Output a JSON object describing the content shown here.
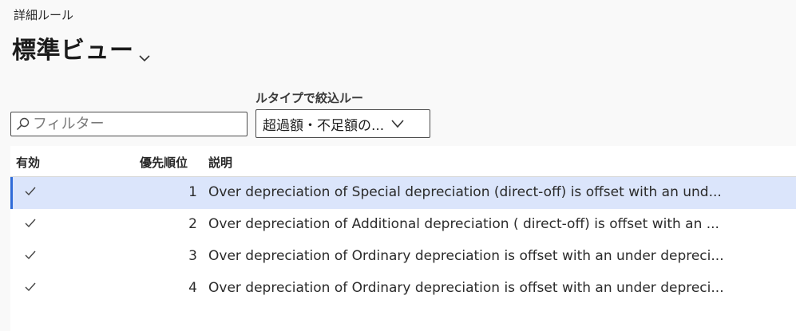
{
  "page": {
    "caption": "詳細ルール",
    "view_title": "標準ビュー"
  },
  "filter": {
    "placeholder": "フィルター",
    "value": ""
  },
  "rule_type_filter": {
    "label": "ルタイプで絞込ルー",
    "selected": "超過額・不足額の..."
  },
  "grid": {
    "columns": [
      "有効",
      "優先順位",
      "説明"
    ],
    "rows": [
      {
        "enabled": true,
        "priority": "1",
        "description": "Over depreciation of Special depreciation (direct-off) is offset with an und...",
        "selected": true
      },
      {
        "enabled": true,
        "priority": "2",
        "description": "Over depreciation of Additional depreciation ( direct-off) is offset with an ...",
        "selected": false
      },
      {
        "enabled": true,
        "priority": "3",
        "description": "Over depreciation of Ordinary depreciation is offset with an under depreci...",
        "selected": false
      },
      {
        "enabled": true,
        "priority": "4",
        "description": "Over depreciation of Ordinary depreciation is offset with an under depreci...",
        "selected": false
      }
    ]
  },
  "colors": {
    "selected_row": "#dbe5fb",
    "selected_accent": "#2f6bd8"
  },
  "icons": {
    "search": "search-icon",
    "chevron": "chevron-down-icon",
    "check": "checkmark-icon"
  }
}
